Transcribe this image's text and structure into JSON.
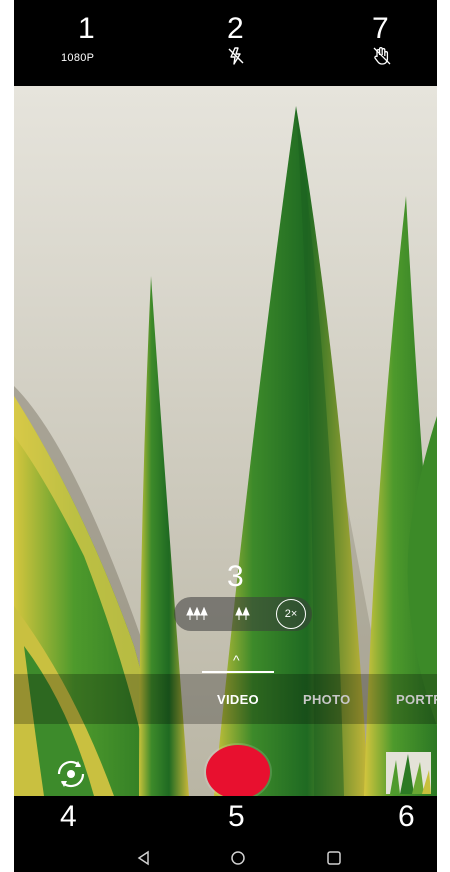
{
  "topbar": {
    "marker_resolution": "1",
    "resolution_label": "1080P",
    "marker_flash": "2",
    "marker_gesture": "7"
  },
  "zoom": {
    "marker": "3",
    "active_label": "2×"
  },
  "modes": {
    "items": [
      "VIDEO",
      "PHOTO",
      "PORTRA"
    ],
    "active_color": "#ffffff",
    "inactive_color": "#c8c8c8"
  },
  "controls": {
    "marker_switch": "4",
    "marker_shutter": "5",
    "marker_gallery": "6",
    "shutter_color": "#e8102f"
  },
  "icons": {
    "flash": "flash-off-icon",
    "gesture": "gesture-off-icon",
    "switch": "switch-camera-icon",
    "back": "nav-back-icon",
    "home": "nav-home-icon",
    "recents": "nav-recents-icon"
  }
}
